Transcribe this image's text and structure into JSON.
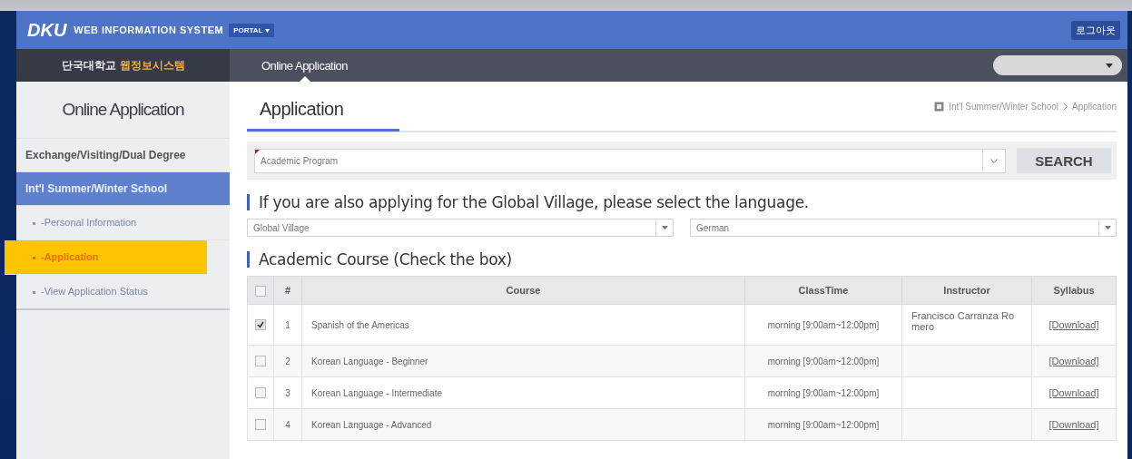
{
  "header": {
    "logo": "DKU",
    "system_name": "WEB INFORMATION SYSTEM",
    "portal_button": "PORTAL",
    "logout_button": "로그아웃"
  },
  "nav": {
    "brand_main": "단국대학교",
    "brand_accent": "웹정보시스템",
    "tabs": [
      {
        "label": "Online Application",
        "selected": true
      }
    ]
  },
  "sidebar": {
    "title": "Online Application",
    "items": [
      {
        "label": "Exchange/Visiting/Dual Degree",
        "selected": false
      },
      {
        "label": "Int'l Summer/Winter School",
        "selected": true,
        "children": [
          {
            "label": "-Personal Information",
            "selected": false
          },
          {
            "label": "-Application",
            "selected": true
          },
          {
            "label": "-View Application Status",
            "selected": false
          }
        ]
      }
    ]
  },
  "page": {
    "title": "Application",
    "breadcrumb": [
      "Int'l Summer/Winter School",
      "Application"
    ]
  },
  "program_select": {
    "value": "Academic Program",
    "required": true
  },
  "search_button": "SEARCH",
  "language_section": {
    "heading": "If you are also applying for the Global Village, please select the language.",
    "selects": [
      "Global Village",
      "German"
    ]
  },
  "course_section": {
    "heading": "Academic Course (Check the box)"
  },
  "table": {
    "header_checked": false,
    "columns": [
      "#",
      "Course",
      "ClassTime",
      "Instructor",
      "Syllabus"
    ],
    "rows": [
      {
        "checked": true,
        "number": "1",
        "course": "Spanish of the Americas",
        "class_time": "morning [9:00am~12:00pm]",
        "instructor": "Francisco Carranza Romero",
        "syllabus": "[Download]"
      },
      {
        "checked": false,
        "number": "2",
        "course": "Korean Language - Beginner",
        "class_time": "morning [9:00am~12:00pm]",
        "syllabus": "[Download]"
      },
      {
        "checked": false,
        "number": "3",
        "course": "Korean Language - Intermediate",
        "class_time": "morning [9:00am~12:00pm]",
        "syllabus": "[Download]"
      },
      {
        "checked": false,
        "number": "4",
        "course": "Korean Language - Advanced",
        "class_time": "morning [9:00am~12:00pm]",
        "syllabus": "[Download]"
      }
    ]
  }
}
